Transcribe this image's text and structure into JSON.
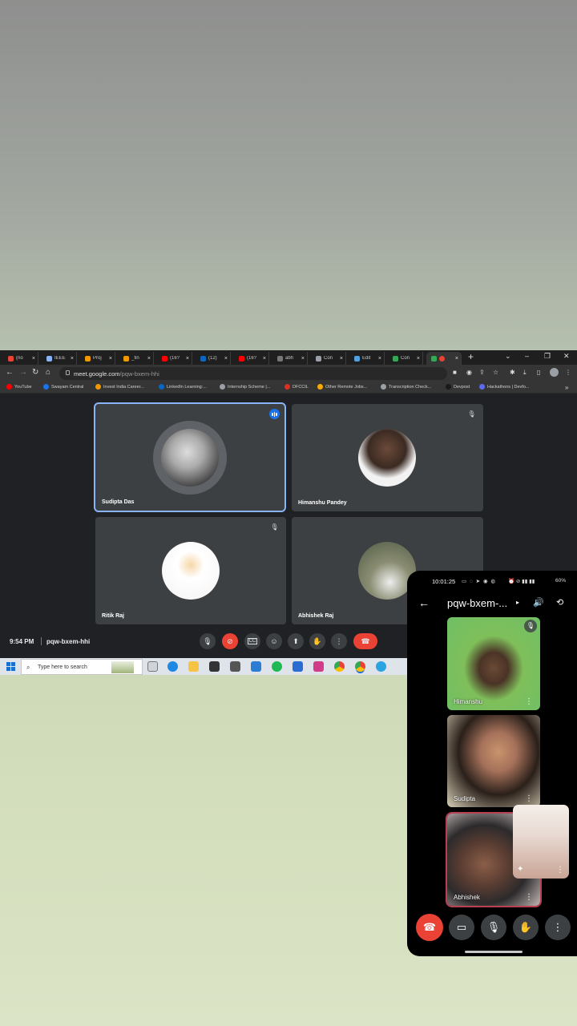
{
  "browser": {
    "tabs": [
      {
        "label": "(no",
        "color": "#ea4335"
      },
      {
        "label": "IEEE",
        "color": "#8ab4f8"
      },
      {
        "label": "Proj",
        "color": "#f29900"
      },
      {
        "label": "_fin",
        "color": "#f29900"
      },
      {
        "label": "(16?",
        "color": "#ff0000"
      },
      {
        "label": "(12)",
        "color": "#0a66c2"
      },
      {
        "label": "(16?",
        "color": "#ff0000"
      },
      {
        "label": "abh",
        "color": "#777777"
      },
      {
        "label": "Con",
        "color": "#9aa0a6"
      },
      {
        "label": "Edit",
        "color": "#4fa3e0"
      },
      {
        "label": "Con",
        "color": "#34a853"
      },
      {
        "label": "",
        "color": "#34a853"
      }
    ],
    "close_glyph": "×",
    "new_tab": "+",
    "url_host": "meet.google.com",
    "url_path": "/pqw-bxem-hhi",
    "bookmarks": [
      {
        "label": "YouTube",
        "color": "#ff0000"
      },
      {
        "label": "Swayam Central",
        "color": "#1a73e8"
      },
      {
        "label": "Invest India Career...",
        "color": "#f29900"
      },
      {
        "label": "LinkedIn Learning:...",
        "color": "#0a66c2"
      },
      {
        "label": "Internship Scheme |...",
        "color": "#9aa0a6"
      },
      {
        "label": "DFCCIL",
        "color": "#d93025"
      },
      {
        "label": "Other Remote Jobs...",
        "color": "#f9ab00"
      },
      {
        "label": "Transcription Check...",
        "color": "#9aa0a6"
      },
      {
        "label": "Devpost",
        "color": "#1a1a1a"
      },
      {
        "label": "Hackathons | Devfo...",
        "color": "#5b6cf0"
      }
    ]
  },
  "meet": {
    "participants": [
      {
        "name": "Sudipta Das",
        "speaking": true,
        "muted": false
      },
      {
        "name": "Himanshu Pandey",
        "speaking": false,
        "muted": true
      },
      {
        "name": "Ritik Raj",
        "speaking": false,
        "muted": true
      },
      {
        "name": "Abhishek Raj",
        "speaking": false,
        "muted": false
      }
    ],
    "time": "9:54 PM",
    "meeting_code": "pqw-bxem-hhi",
    "accent_color": "#8ab4f8",
    "hangup_color": "#ea4335"
  },
  "taskbar": {
    "search_placeholder": "Type here to search"
  },
  "phone": {
    "status_time": "10:01:25",
    "battery": "60%",
    "title": "pqw-bxem-...",
    "tiles": [
      {
        "name": "Himanshu"
      },
      {
        "name": "Sudipta"
      },
      {
        "name": "Abhishek"
      }
    ]
  }
}
